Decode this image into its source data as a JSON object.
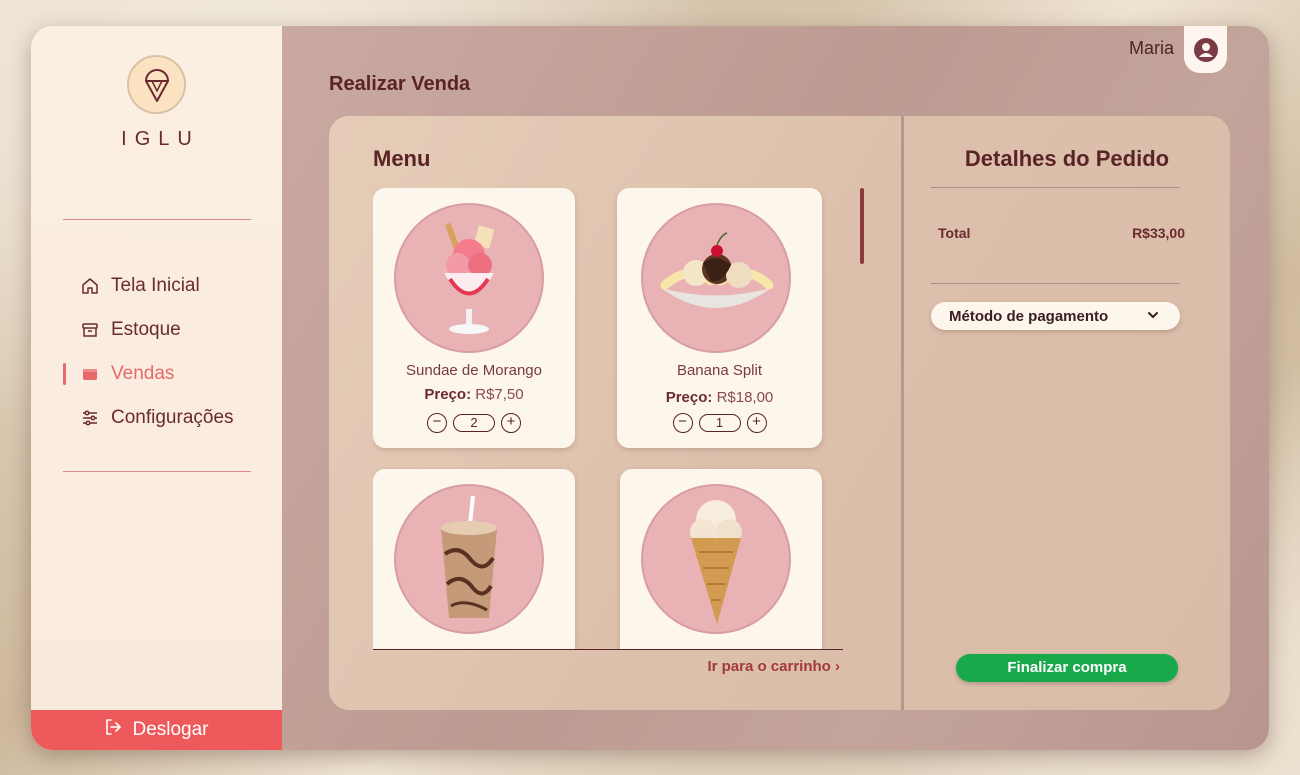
{
  "brand": {
    "name": "IGLU",
    "logo_icon": "ice-cream-cone-icon"
  },
  "sidebar": {
    "items": [
      {
        "label": "Tela Inicial",
        "icon": "home-icon",
        "active": false
      },
      {
        "label": "Estoque",
        "icon": "archive-icon",
        "active": false
      },
      {
        "label": "Vendas",
        "icon": "wallet-icon",
        "active": true
      },
      {
        "label": "Configurações",
        "icon": "sliders-icon",
        "active": false
      }
    ],
    "logout_label": "Deslogar"
  },
  "user": {
    "name": "Maria"
  },
  "page": {
    "title": "Realizar Venda"
  },
  "menu": {
    "title": "Menu",
    "price_label": "Preço:",
    "items": [
      {
        "name": "Sundae de Morango",
        "price": "R$7,50",
        "quantity": "2"
      },
      {
        "name": "Banana Split",
        "price": "R$18,00",
        "quantity": "1"
      },
      {
        "name": "",
        "price": "",
        "quantity": ""
      },
      {
        "name": "",
        "price": "",
        "quantity": ""
      }
    ],
    "cart_link": "Ir para o carrinho ›"
  },
  "order": {
    "title": "Detalhes do Pedido",
    "total_label": "Total",
    "total_value": "R$33,00",
    "payment_placeholder": "Método de pagamento",
    "finish_label": "Finalizar compra"
  },
  "colors": {
    "accent": "#e8696a",
    "finish": "#19a84a",
    "text_dark": "#5a2326"
  }
}
